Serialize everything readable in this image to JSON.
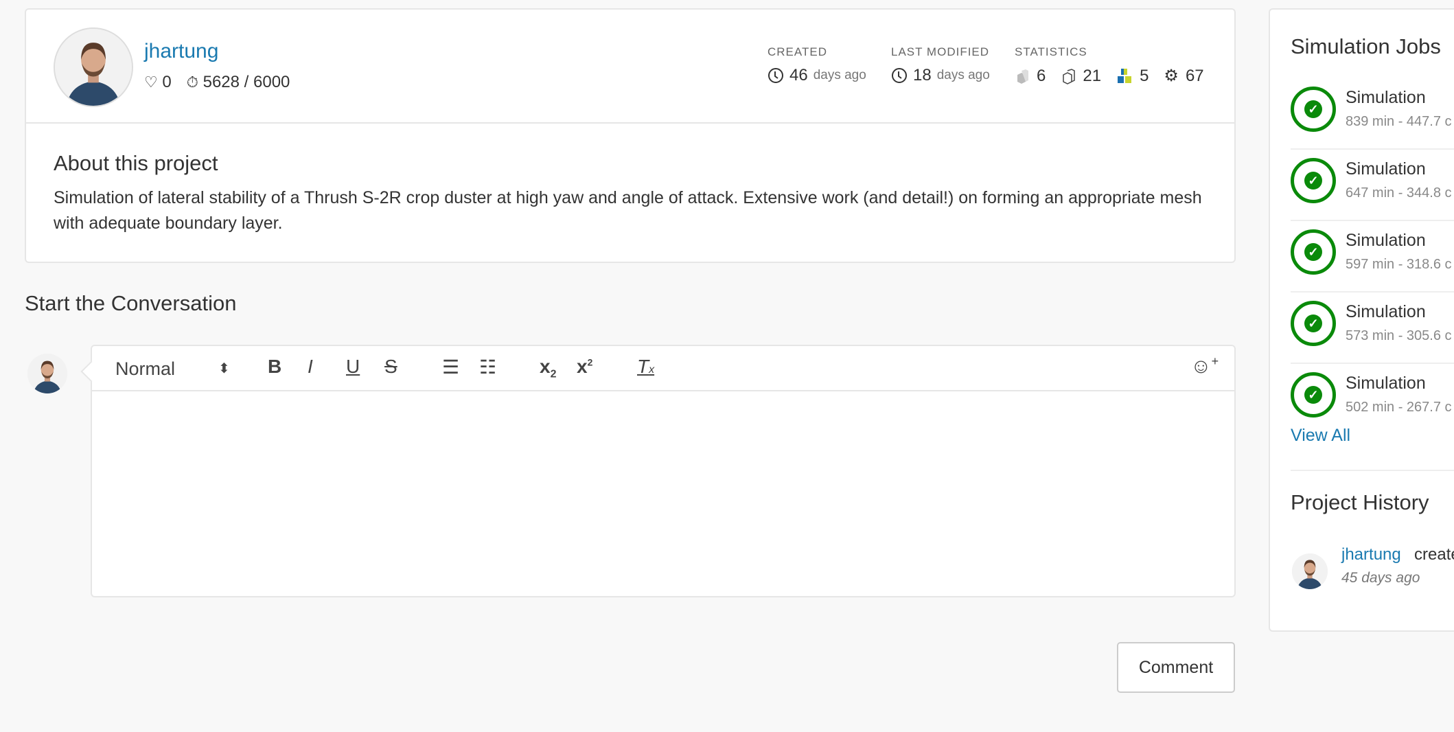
{
  "user": {
    "name": "jhartung",
    "likes": "0",
    "quota": "5628 / 6000"
  },
  "meta": {
    "created_label": "CREATED",
    "created_num": "46",
    "created_unit": "days ago",
    "modified_label": "LAST MODIFIED",
    "modified_num": "18",
    "modified_unit": "days ago",
    "stats_label": "STATISTICS",
    "stats": [
      "6",
      "21",
      "5",
      "67"
    ]
  },
  "about": {
    "title": "About this project",
    "text": "Simulation of lateral stability of a Thrush S-2R crop duster at high yaw and angle of attack. Extensive work (and detail!) on forming an appropriate mesh with adequate boundary layer."
  },
  "conversation": {
    "title": "Start the Conversation",
    "format": "Normal",
    "comment_label": "Comment"
  },
  "jobs": {
    "title": "Simulation Jobs",
    "items": [
      {
        "name": "Simulation",
        "detail": "839 min - 447.7 c"
      },
      {
        "name": "Simulation",
        "detail": "647 min - 344.8 c"
      },
      {
        "name": "Simulation",
        "detail": "597 min - 318.6 c"
      },
      {
        "name": "Simulation",
        "detail": "573 min - 305.6 c"
      },
      {
        "name": "Simulation",
        "detail": "502 min - 267.7 c"
      }
    ],
    "view_all": "View All"
  },
  "history": {
    "title": "Project History",
    "user": "jhartung",
    "action": "create",
    "time": "45 days ago"
  }
}
